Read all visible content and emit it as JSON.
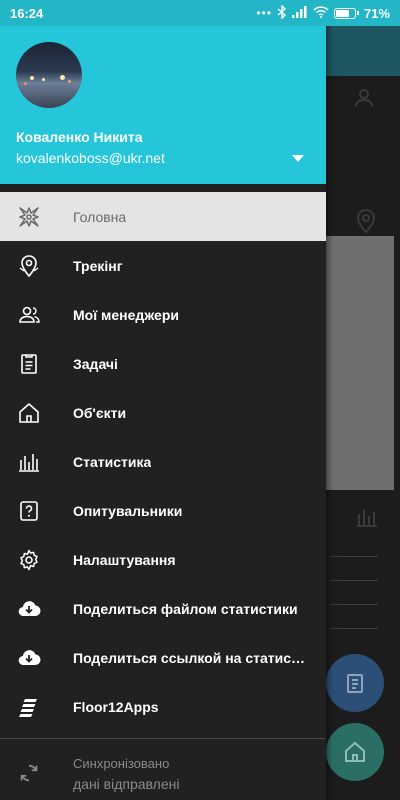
{
  "status_bar": {
    "time": "16:24",
    "dots": "•••",
    "battery": "71%",
    "battery_level": 0.71
  },
  "drawer": {
    "user": {
      "name": "Коваленко Никита",
      "email": "kovalenkoboss@ukr.net"
    },
    "menu": [
      {
        "label": "Головна",
        "icon": "compass-icon",
        "active": true
      },
      {
        "label": "Трекінг",
        "icon": "map-pin-icon",
        "active": false
      },
      {
        "label": "Мої менеджери",
        "icon": "people-icon",
        "active": false
      },
      {
        "label": "Задачі",
        "icon": "clipboard-icon",
        "active": false
      },
      {
        "label": "Об'єкти",
        "icon": "house-icon",
        "active": false
      },
      {
        "label": "Статистика",
        "icon": "bar-chart-icon",
        "active": false
      },
      {
        "label": "Опитувальники",
        "icon": "question-icon",
        "active": false
      },
      {
        "label": "Налаштування",
        "icon": "gear-icon",
        "active": false
      },
      {
        "label": "Поделиться файлом статистики",
        "icon": "cloud-download-icon",
        "active": false
      },
      {
        "label": "Поделиться ссылкой на статистику",
        "icon": "cloud-download-icon",
        "active": false
      },
      {
        "label": "Floor12Apps",
        "icon": "floor12-logo-icon",
        "active": false
      }
    ],
    "sync": {
      "status": "Синхронізовано",
      "detail": "дані відправлені"
    }
  },
  "colors": {
    "header": "#26c6da",
    "drawer_bg": "#212121",
    "active_item_bg": "#e4e4e4",
    "status_bar": "#23b6c7"
  }
}
